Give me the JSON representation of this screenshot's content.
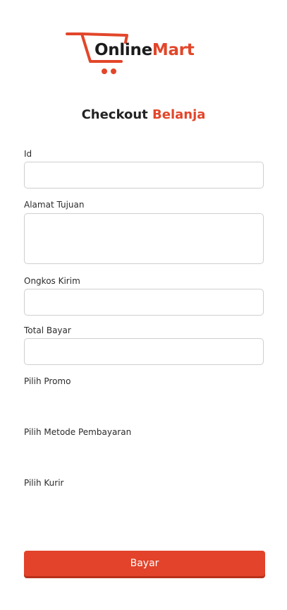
{
  "logo": {
    "part1": "Online",
    "part2": "Mart"
  },
  "title": {
    "part1": "Checkout",
    "part2": "Belanja"
  },
  "form": {
    "id_label": "Id",
    "id_value": "",
    "address_label": "Alamat Tujuan",
    "address_value": "",
    "shipping_label": "Ongkos Kirim",
    "shipping_value": "",
    "total_label": "Total Bayar",
    "total_value": "",
    "promo_label": "Pilih Promo",
    "payment_method_label": "Pilih Metode Pembayaran",
    "courier_label": "Pilih Kurir",
    "submit_label": "Bayar"
  },
  "colors": {
    "accent": "#e2462a",
    "text": "#222222",
    "border": "#cfcfcf"
  },
  "icons": {
    "logo": "shopping-cart-icon"
  }
}
